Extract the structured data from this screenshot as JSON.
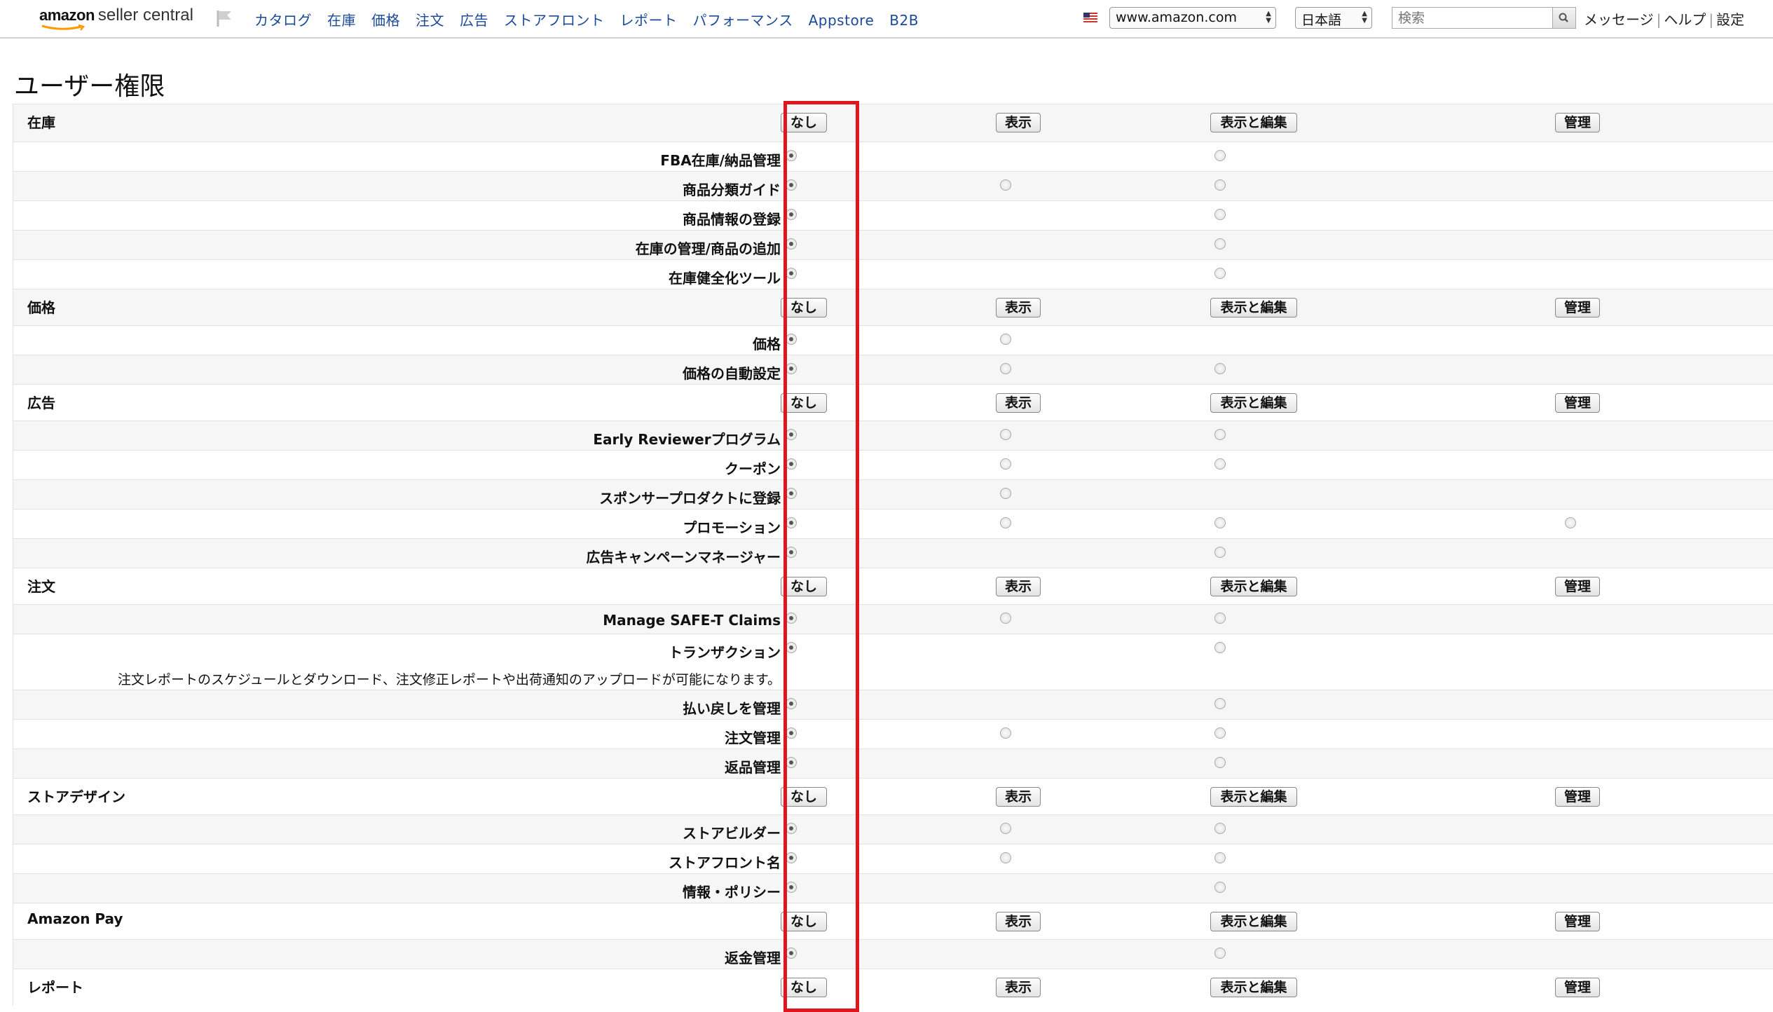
{
  "header": {
    "logo_primary": "amazon",
    "logo_secondary": "seller central",
    "nav_items": [
      "カタログ",
      "在庫",
      "価格",
      "注文",
      "広告",
      "ストアフロント",
      "レポート",
      "パフォーマンス",
      "Appstore",
      "B2B"
    ],
    "marketplace": "www.amazon.com",
    "language": "日本語",
    "search_placeholder": "検索",
    "links": [
      "メッセージ",
      "ヘルプ",
      "設定"
    ]
  },
  "page": {
    "title": "ユーザー権限"
  },
  "levels": [
    "なし",
    "表示",
    "表示と編集",
    "管理"
  ],
  "colors": {
    "highlight": "#e0161f",
    "nav_link": "#1a4a9a"
  },
  "rows": [
    {
      "type": "category",
      "label": "在庫"
    },
    {
      "type": "permission",
      "label": "FBA在庫/納品管理",
      "options": [
        0,
        2
      ],
      "selected": 0
    },
    {
      "type": "permission",
      "label": "商品分類ガイド",
      "options": [
        0,
        1,
        2
      ],
      "selected": 0
    },
    {
      "type": "permission",
      "label": "商品情報の登録",
      "options": [
        0,
        2
      ],
      "selected": 0
    },
    {
      "type": "permission",
      "label": "在庫の管理/商品の追加",
      "options": [
        0,
        2
      ],
      "selected": 0
    },
    {
      "type": "permission",
      "label": "在庫健全化ツール",
      "options": [
        0,
        2
      ],
      "selected": 0
    },
    {
      "type": "category",
      "label": "価格"
    },
    {
      "type": "permission",
      "label": "価格",
      "options": [
        0,
        1
      ],
      "selected": 0
    },
    {
      "type": "permission",
      "label": "価格の自動設定",
      "options": [
        0,
        1,
        2
      ],
      "selected": 0
    },
    {
      "type": "category",
      "label": "広告"
    },
    {
      "type": "permission",
      "label": "Early Reviewerプログラム",
      "options": [
        0,
        1,
        2
      ],
      "selected": 0
    },
    {
      "type": "permission",
      "label": "クーポン",
      "options": [
        0,
        1,
        2
      ],
      "selected": 0
    },
    {
      "type": "permission",
      "label": "スポンサープロダクトに登録",
      "options": [
        0,
        1
      ],
      "selected": 0
    },
    {
      "type": "permission",
      "label": "プロモーション",
      "options": [
        0,
        1,
        2,
        3
      ],
      "selected": 0
    },
    {
      "type": "permission",
      "label": "広告キャンペーンマネージャー",
      "options": [
        0,
        2
      ],
      "selected": 0
    },
    {
      "type": "category",
      "label": "注文"
    },
    {
      "type": "permission",
      "label": "Manage SAFE-T Claims",
      "options": [
        0,
        1,
        2
      ],
      "selected": 0
    },
    {
      "type": "permission",
      "label": "トランザクション",
      "options": [
        0,
        2
      ],
      "selected": 0,
      "description": "注文レポートのスケジュールとダウンロード、注文修正レポートや出荷通知のアップロードが可能になります。"
    },
    {
      "type": "permission",
      "label": "払い戻しを管理",
      "options": [
        0,
        2
      ],
      "selected": 0
    },
    {
      "type": "permission",
      "label": "注文管理",
      "options": [
        0,
        1,
        2
      ],
      "selected": 0
    },
    {
      "type": "permission",
      "label": "返品管理",
      "options": [
        0,
        2
      ],
      "selected": 0
    },
    {
      "type": "category",
      "label": "ストアデザイン"
    },
    {
      "type": "permission",
      "label": "ストアビルダー",
      "options": [
        0,
        1,
        2
      ],
      "selected": 0
    },
    {
      "type": "permission",
      "label": "ストアフロント名",
      "options": [
        0,
        1,
        2
      ],
      "selected": 0
    },
    {
      "type": "permission",
      "label": "情報・ポリシー",
      "options": [
        0,
        2
      ],
      "selected": 0
    },
    {
      "type": "category",
      "label": "Amazon Pay"
    },
    {
      "type": "permission",
      "label": "返金管理",
      "options": [
        0,
        2
      ],
      "selected": 0
    },
    {
      "type": "category",
      "label": "レポート"
    }
  ]
}
